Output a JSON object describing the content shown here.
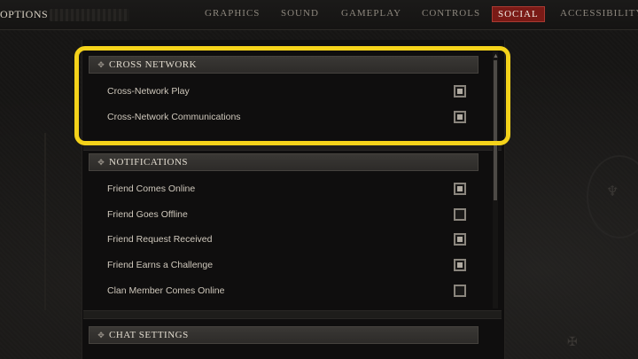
{
  "header": {
    "title": "OPTIONS",
    "tabs": [
      {
        "label": "GRAPHICS"
      },
      {
        "label": "SOUND"
      },
      {
        "label": "GAMEPLAY"
      },
      {
        "label": "CONTROLS"
      },
      {
        "label": "SOCIAL"
      },
      {
        "label": "ACCESSIBILITY"
      }
    ],
    "active_tab": "SOCIAL"
  },
  "sections": [
    {
      "title": "CROSS NETWORK",
      "items": [
        {
          "label": "Cross-Network Play",
          "checked": true
        },
        {
          "label": "Cross-Network Communications",
          "checked": true
        }
      ]
    },
    {
      "title": "NOTIFICATIONS",
      "items": [
        {
          "label": "Friend Comes Online",
          "checked": true
        },
        {
          "label": "Friend Goes Offline",
          "checked": false
        },
        {
          "label": "Friend Request Received",
          "checked": true
        },
        {
          "label": "Friend Earns a Challenge",
          "checked": true
        },
        {
          "label": "Clan Member Comes Online",
          "checked": false
        }
      ]
    },
    {
      "title": "CHAT SETTINGS",
      "items": []
    }
  ],
  "colors": {
    "accent_highlight": "#f4d21a",
    "active_tab_bg": "#7a1a16"
  },
  "icons": {
    "section_icon": "diamond-dots-icon",
    "scroll_up": "chevron-up-icon"
  }
}
